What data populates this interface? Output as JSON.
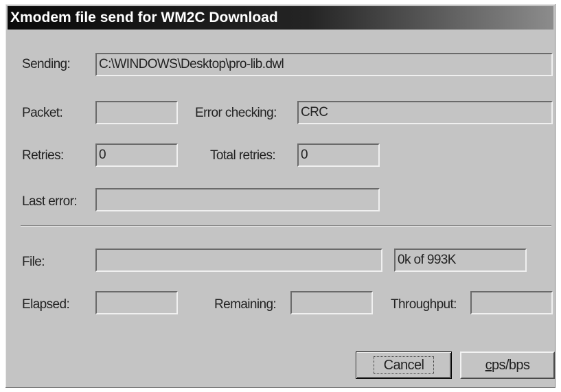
{
  "window": {
    "title": "Xmodem file send for WM2C Download"
  },
  "sending": {
    "label": "Sending:",
    "value": "C:\\WINDOWS\\Desktop\\pro-lib.dwl"
  },
  "packet": {
    "label": "Packet:",
    "value": ""
  },
  "error_checking": {
    "label": "Error checking:",
    "value": "CRC"
  },
  "retries": {
    "label": "Retries:",
    "value": "0"
  },
  "total_retries": {
    "label": "Total retries:",
    "value": "0"
  },
  "last_error": {
    "label": "Last error:",
    "value": ""
  },
  "file": {
    "label": "File:",
    "progress_fraction": 0,
    "size_text": "0k of 993K"
  },
  "elapsed": {
    "label": "Elapsed:",
    "value": ""
  },
  "remaining": {
    "label": "Remaining:",
    "value": ""
  },
  "throughput": {
    "label": "Throughput:",
    "value": ""
  },
  "buttons": {
    "cancel": "Cancel",
    "cps_mnemonic": "c",
    "cps_rest": "ps/bps"
  }
}
